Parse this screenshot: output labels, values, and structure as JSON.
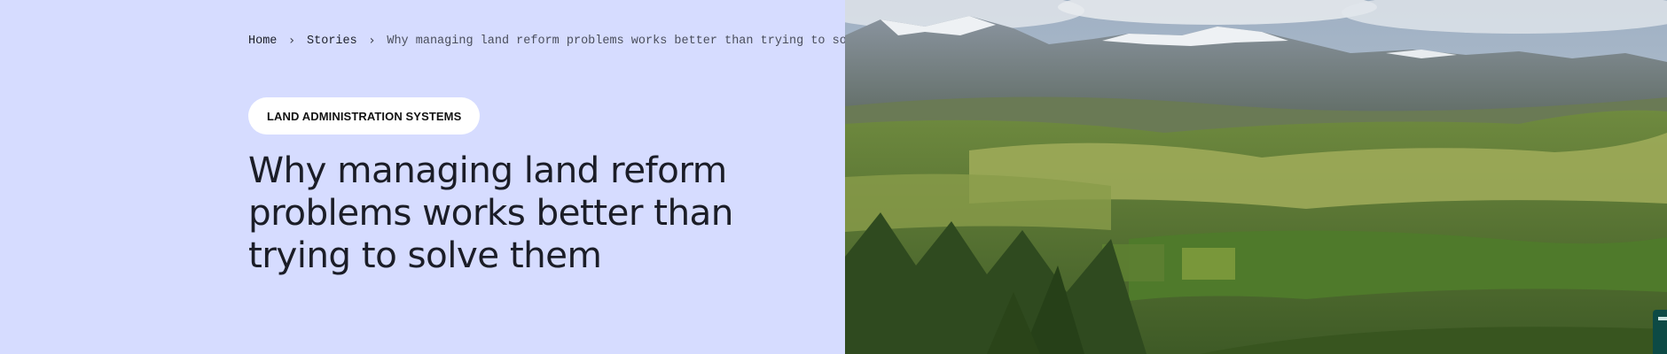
{
  "breadcrumb": {
    "home": "Home",
    "stories": "Stories",
    "current": "Why managing land reform problems works better than trying to solve them",
    "separator": "›"
  },
  "tag": "LAND ADMINISTRATION SYSTEMS",
  "title": "Why managing land reform problems works better than trying to solve them",
  "colors": {
    "panel_background": "#d6dcff",
    "tag_background": "#ffffff",
    "text": "#1b1d27",
    "corner_badge": "#0d4a45"
  },
  "hero_image": {
    "icon": "landscape-photo"
  }
}
